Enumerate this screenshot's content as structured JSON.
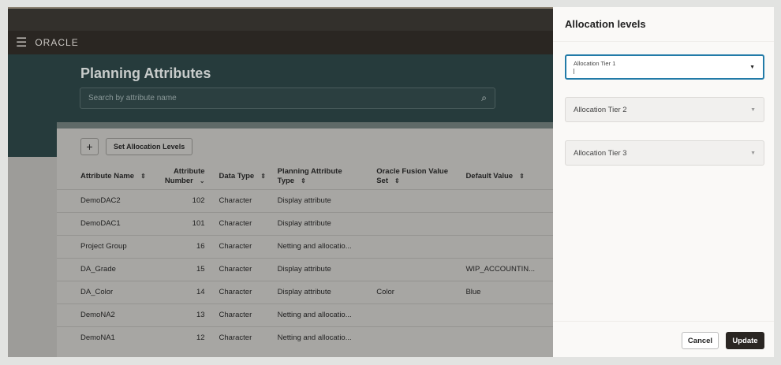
{
  "header": {
    "logo": "ORACLE",
    "menu_icon": "hamburger-icon"
  },
  "page": {
    "title": "Planning Attributes",
    "search_placeholder": "Search by attribute name"
  },
  "toolbar": {
    "add_label": "+",
    "set_allocation_label": "Set Allocation Levels"
  },
  "table": {
    "columns": [
      "Attribute Name",
      "Attribute Number",
      "Data Type",
      "Planning Attribute Type",
      "Oracle Fusion Value Set",
      "Default Value"
    ],
    "rows": [
      [
        "DemoDAC2",
        "102",
        "Character",
        "Display attribute",
        "",
        ""
      ],
      [
        "DemoDAC1",
        "101",
        "Character",
        "Display attribute",
        "",
        ""
      ],
      [
        "Project Group",
        "16",
        "Character",
        "Netting and allocatio...",
        "",
        ""
      ],
      [
        "DA_Grade",
        "15",
        "Character",
        "Display attribute",
        "",
        "WIP_ACCOUNTIN..."
      ],
      [
        "DA_Color",
        "14",
        "Character",
        "Display attribute",
        "Color",
        "Blue"
      ],
      [
        "DemoNA2",
        "13",
        "Character",
        "Netting and allocatio...",
        "",
        ""
      ],
      [
        "DemoNA1",
        "12",
        "Character",
        "Netting and allocatio...",
        "",
        ""
      ]
    ]
  },
  "panel": {
    "title": "Allocation levels",
    "tier1": "Allocation Tier 1",
    "tier2": "Allocation Tier 2",
    "tier3": "Allocation Tier 3",
    "cancel": "Cancel",
    "update": "Update"
  },
  "colors": {
    "accent": "#227ba8",
    "primary_button": "#2a2622"
  }
}
